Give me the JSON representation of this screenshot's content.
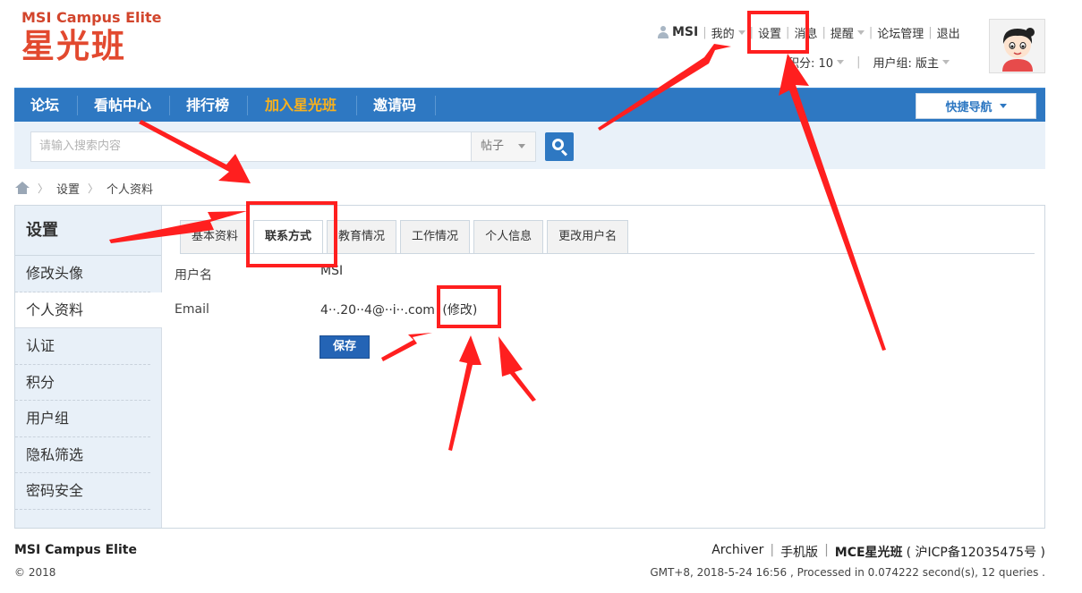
{
  "logo": {
    "en": "MSI Campus Elite",
    "cn": "星光班"
  },
  "userbar": {
    "username": "MSI",
    "items": [
      "我的",
      "设置",
      "消息",
      "提醒",
      "论坛管理",
      "退出"
    ],
    "points": "积分: 10",
    "group": "用户组: 版主"
  },
  "nav": {
    "items": [
      "论坛",
      "看帖中心",
      "排行榜",
      "加入星光班",
      "邀请码"
    ],
    "quick_nav": "快捷导航"
  },
  "search": {
    "placeholder": "请输入搜索内容",
    "type": "帖子"
  },
  "breadcrumb": [
    "设置",
    "个人资料"
  ],
  "sidebar": {
    "title": "设置",
    "items": [
      "修改头像",
      "个人资料",
      "认证",
      "积分",
      "用户组",
      "隐私筛选",
      "密码安全"
    ]
  },
  "tabs": [
    "基本资料",
    "联系方式",
    "教育情况",
    "工作情况",
    "个人信息",
    "更改用户名"
  ],
  "form": {
    "username_label": "用户名",
    "username_value": "MSI",
    "email_label": "Email",
    "email_value": "4··.20··4@··i··.com",
    "email_edit": "(修改)",
    "save": "保存"
  },
  "footer": {
    "brand": "MSI Campus Elite",
    "copyright": "© 2018",
    "links": [
      "Archiver",
      "手机版"
    ],
    "site_name": "MCE星光班",
    "icp": "( 沪ICP备12035475号 )",
    "stats": "GMT+8, 2018-5-24 16:56 , Processed in 0.074222 second(s), 12 queries ."
  },
  "colors": {
    "logo_red": "#e2492f",
    "nav_blue": "#2e78c2",
    "nav_active": "#f9b11c",
    "annotation_red": "#ff1f1f"
  }
}
